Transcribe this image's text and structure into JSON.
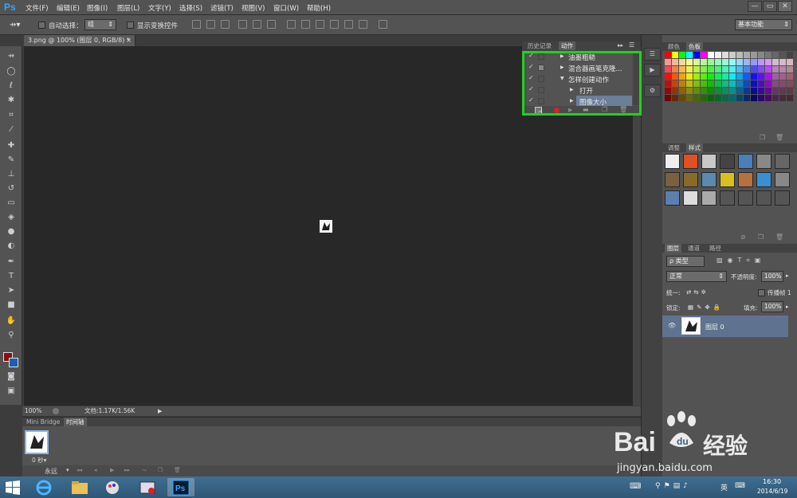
{
  "app": {
    "logo": "Ps"
  },
  "menu": [
    {
      "label": "文件(F)"
    },
    {
      "label": "编辑(E)"
    },
    {
      "label": "图像(I)"
    },
    {
      "label": "图层(L)"
    },
    {
      "label": "文字(Y)"
    },
    {
      "label": "选择(S)"
    },
    {
      "label": "滤镜(T)"
    },
    {
      "label": "视图(V)"
    },
    {
      "label": "窗口(W)"
    },
    {
      "label": "帮助(H)"
    }
  ],
  "window_controls": {
    "minimize": "—",
    "maximize": "▭",
    "close": "✕"
  },
  "options": {
    "auto_select_label": "自动选择：",
    "auto_select_value": "组",
    "show_transform_label": "显示变换控件",
    "workspace": "基本功能"
  },
  "document": {
    "tab_title": "3.png @ 100% (图层 0, RGB/8) *",
    "tab_close": "×",
    "zoom": "100%",
    "doc_info": "文档:1.17K/1.56K"
  },
  "bottom_panel": {
    "tabs": [
      {
        "label": "Mini Bridge"
      },
      {
        "label": "时间轴"
      }
    ],
    "frame_time": "0 秒▾",
    "loop": "永远"
  },
  "actions_panel": {
    "tabs": [
      {
        "label": "历史记录"
      },
      {
        "label": "动作"
      }
    ],
    "rows": [
      {
        "check": "✓",
        "label": "油墨粗糙"
      },
      {
        "check": "✓",
        "label": "混合器画笔克隆..."
      },
      {
        "check": "✓",
        "label": "怎样创建动作"
      },
      {
        "check": "✓",
        "label": "打开"
      },
      {
        "check": "✓",
        "label": "图像大小"
      }
    ]
  },
  "swatches_panel": {
    "tabs": [
      {
        "label": "颜色"
      },
      {
        "label": "色板"
      }
    ]
  },
  "styles_panel": {
    "tabs": [
      {
        "label": "调整"
      },
      {
        "label": "样式"
      }
    ]
  },
  "layers_panel": {
    "tabs": [
      {
        "label": "图层"
      },
      {
        "label": "通道"
      },
      {
        "label": "路径"
      }
    ],
    "filter_label": "ρ 类型",
    "blend_mode": "正常",
    "opacity_label": "不透明度:",
    "opacity_value": "100%",
    "unify_label": "统一:",
    "propagate_label": "传播帧 1",
    "lock_label": "锁定:",
    "fill_label": "填充:",
    "fill_value": "100%",
    "layer_name": "图层 0"
  },
  "taskbar": {
    "ime": "英",
    "time": "16:30",
    "date": "2014/6/19"
  },
  "watermark": {
    "brand": "Bai",
    "brand2": "经验",
    "url": "jingyan.baidu.com"
  },
  "colors": {
    "highlight_box": "#1fd11f",
    "foreground": "#8a0f0f",
    "background": "#1a5fb4"
  }
}
